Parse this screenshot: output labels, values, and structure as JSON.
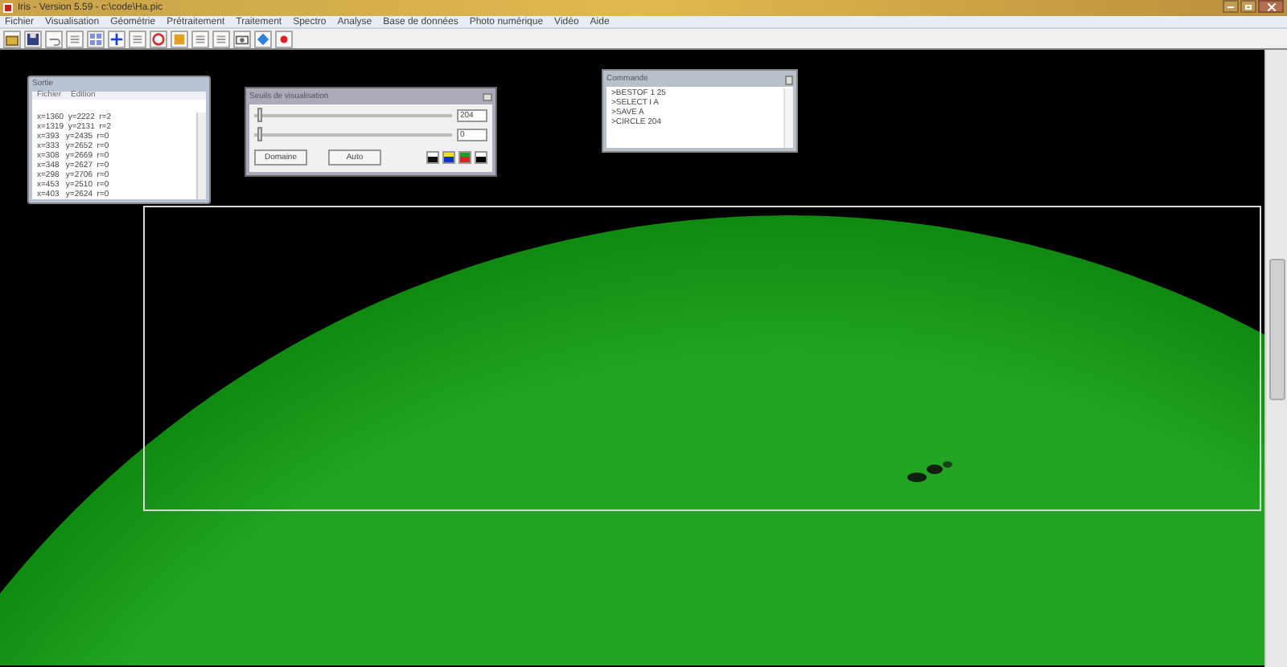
{
  "window": {
    "title": "Iris - Version 5.59 - c:\\code\\Ha.pic"
  },
  "menu": [
    "Fichier",
    "Visualisation",
    "Géométrie",
    "Prétraitement",
    "Traitement",
    "Spectro",
    "Analyse",
    "Base de données",
    "Photo numérique",
    "Vidéo",
    "Aide"
  ],
  "toolbar": [
    {
      "kind": "open"
    },
    {
      "kind": "save"
    },
    {
      "kind": "undo"
    },
    {
      "kind": "plain"
    },
    {
      "kind": "grid"
    },
    {
      "kind": "move"
    },
    {
      "kind": "plain"
    },
    {
      "kind": "red"
    },
    {
      "kind": "orange"
    },
    {
      "kind": "plain"
    },
    {
      "kind": "plain"
    },
    {
      "kind": "camera"
    },
    {
      "kind": "blue"
    },
    {
      "kind": "dot"
    }
  ],
  "output_window": {
    "title": "Sortie",
    "menu": [
      "Fichier",
      "Edition"
    ],
    "lines": [
      "x=1360  y=2222  r=2",
      "x=1319  y=2131  r=2",
      "x=393   y=2435  r=0",
      "x=333   y=2652  r=0",
      "x=308   y=2669  r=0",
      "x=348   y=2627  r=0",
      "x=298   y=2706  r=0",
      "x=453   y=2510  r=0",
      "x=403   y=2624  r=0"
    ]
  },
  "threshold_window": {
    "title": "Seuils de visualisation",
    "sliders": [
      {
        "level": 0.02,
        "value": "204"
      },
      {
        "level": 0.02,
        "value": "0"
      }
    ],
    "buttons": [
      "Domaine",
      "Auto"
    ]
  },
  "command_window": {
    "title": "Commande",
    "lines": [
      ">BESTOF 1 25",
      ">SELECT I A",
      ">SAVE A",
      ">CIRCLE 204"
    ]
  }
}
